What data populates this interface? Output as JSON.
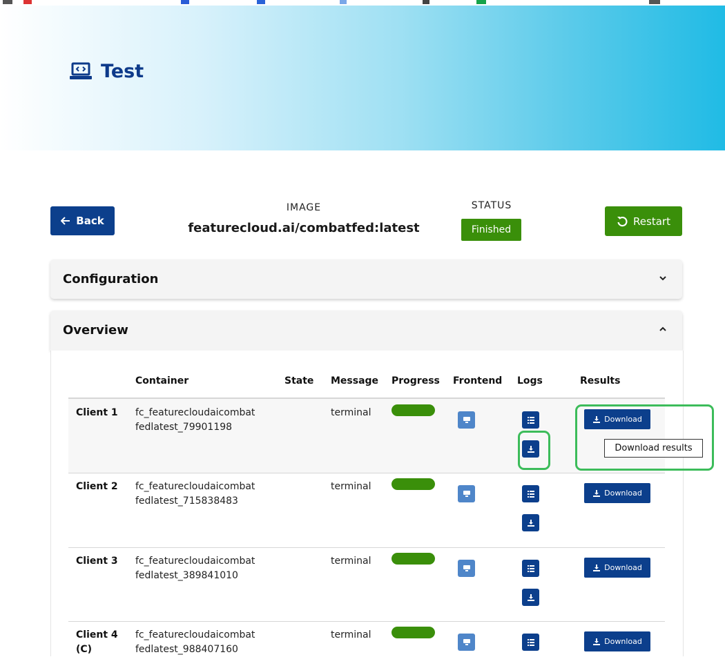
{
  "colors": {
    "primary": "#0c3f8c",
    "success": "#3a8f0a",
    "frontend_button": "#4f86c9",
    "highlight": "#3cbc5a"
  },
  "hero": {
    "title": "Test",
    "icon": "laptop-code-icon"
  },
  "toolbar": {
    "back_label": "Back",
    "image_label": "IMAGE",
    "image_name": "featurecloud.ai/combatfed:latest",
    "status_label": "STATUS",
    "status_value": "Finished",
    "restart_label": "Restart"
  },
  "panels": {
    "configuration": "Configuration",
    "overview": "Overview"
  },
  "table": {
    "headers": [
      "Container",
      "State",
      "Message",
      "Progress",
      "Frontend",
      "Logs",
      "Results"
    ],
    "download_label": "Download",
    "rows": [
      {
        "client": "Client 1",
        "container_line1": "fc_featurecloudaicombat",
        "container_line2": "fedlatest_79901198",
        "state": "",
        "message": "terminal",
        "progress": 1.0
      },
      {
        "client": "Client 2",
        "container_line1": "fc_featurecloudaicombat",
        "container_line2": "fedlatest_715838483",
        "state": "",
        "message": "terminal",
        "progress": 1.0
      },
      {
        "client": "Client 3",
        "container_line1": "fc_featurecloudaicombat",
        "container_line2": "fedlatest_389841010",
        "state": "",
        "message": "terminal",
        "progress": 1.0
      },
      {
        "client": "Client 4",
        "client_suffix": "(C)",
        "container_line1": "fc_featurecloudaicombat",
        "container_line2": "fedlatest_988407160",
        "state": "",
        "message": "terminal",
        "progress": 1.0
      }
    ]
  },
  "tooltip": "Download results"
}
